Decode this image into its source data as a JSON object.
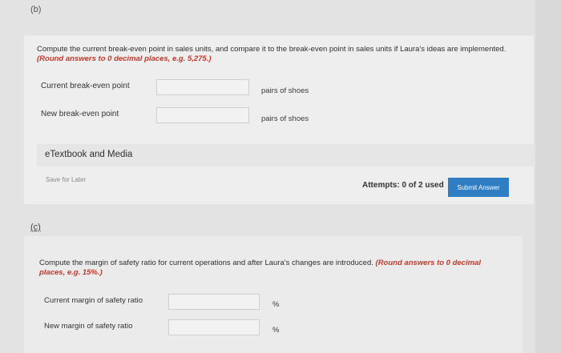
{
  "part_b": {
    "label": "(b)",
    "question": "Compute the current break-even point in sales units, and compare it to the break-even point in sales units if Laura's ideas are implemented.",
    "instruction": "(Round answers to 0 decimal places, e.g. 5,275.)",
    "rows": [
      {
        "label": "Current break-even point",
        "value": "",
        "unit": "pairs of shoes"
      },
      {
        "label": "New break-even point",
        "value": "",
        "unit": "pairs of shoes"
      }
    ],
    "etextbook": "eTextbook and Media",
    "save_for_later": "Save for Later",
    "attempts": "Attempts: 0 of 2 used",
    "submit": "Submit Answer"
  },
  "part_c": {
    "label": "(c)",
    "question": "Compute the margin of safety ratio for current operations and after Laura's changes are introduced.",
    "instruction": "(Round answers to 0 decimal places, e.g. 15%.)",
    "rows": [
      {
        "label": "Current margin of safety ratio",
        "value": "",
        "unit": "%"
      },
      {
        "label": "New margin of safety ratio",
        "value": "",
        "unit": "%"
      }
    ]
  }
}
